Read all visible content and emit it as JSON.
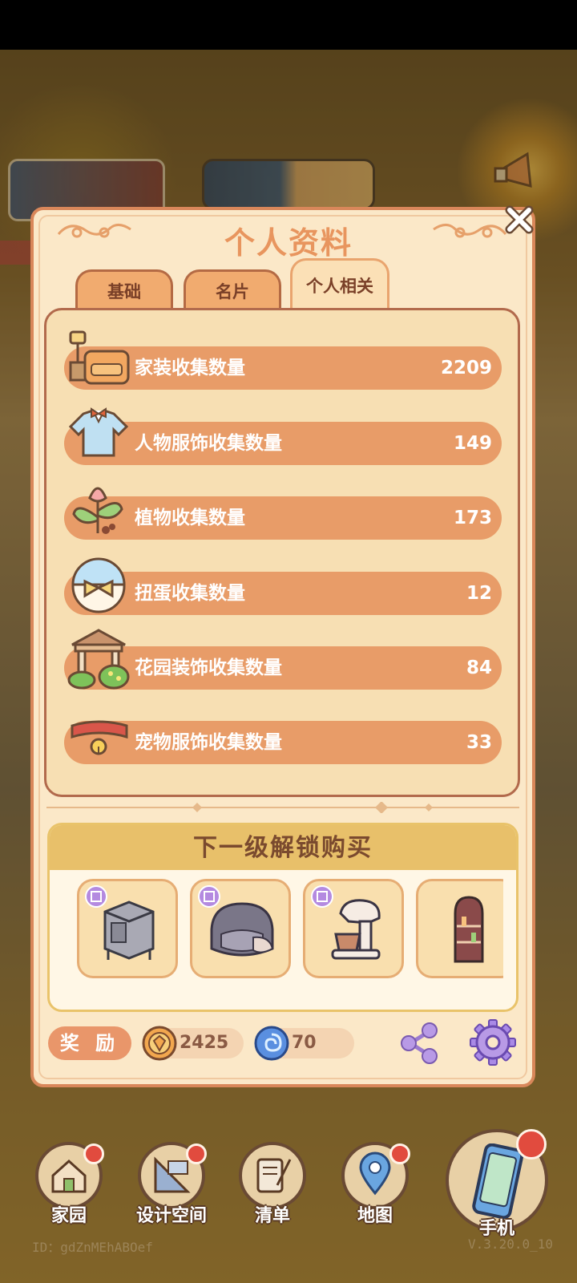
{
  "dialog": {
    "title": "个人资料",
    "tabs": [
      {
        "label": "基础",
        "active": false
      },
      {
        "label": "名片",
        "active": false
      },
      {
        "label": "个人相关",
        "active": true
      }
    ],
    "stats": [
      {
        "label": "家装收集数量",
        "value": "2209",
        "icon": "sofa-lamp-icon"
      },
      {
        "label": "人物服饰收集数量",
        "value": "149",
        "icon": "shirt-icon"
      },
      {
        "label": "植物收集数量",
        "value": "173",
        "icon": "flower-sprout-icon"
      },
      {
        "label": "扭蛋收集数量",
        "value": "12",
        "icon": "capsule-egg-icon"
      },
      {
        "label": "花园装饰收集数量",
        "value": "84",
        "icon": "gazebo-icon"
      },
      {
        "label": "宠物服饰收集数量",
        "value": "33",
        "icon": "pet-collar-icon"
      }
    ],
    "unlock": {
      "title": "下一级解锁购买",
      "items": [
        {
          "name": "appliance-cabinet-icon"
        },
        {
          "name": "armchair-icon"
        },
        {
          "name": "stand-mixer-icon"
        },
        {
          "name": "arched-shelf-icon"
        }
      ]
    },
    "footer": {
      "reward_label": "奖 励",
      "coins": "2425",
      "gems": "70"
    }
  },
  "nav": [
    {
      "label": "家园",
      "badge": true
    },
    {
      "label": "设计空间",
      "badge": true
    },
    {
      "label": "清单",
      "badge": false
    },
    {
      "label": "地图",
      "badge": true
    },
    {
      "label": "手机",
      "badge": true
    }
  ],
  "footer_info": {
    "id": "ID：gdZnMEhABOef",
    "version": "V.3.20.0_10"
  },
  "colors": {
    "accent": "#e89c68",
    "panel_bg": "#fbe8c8",
    "badge_red": "#e14b3e"
  }
}
